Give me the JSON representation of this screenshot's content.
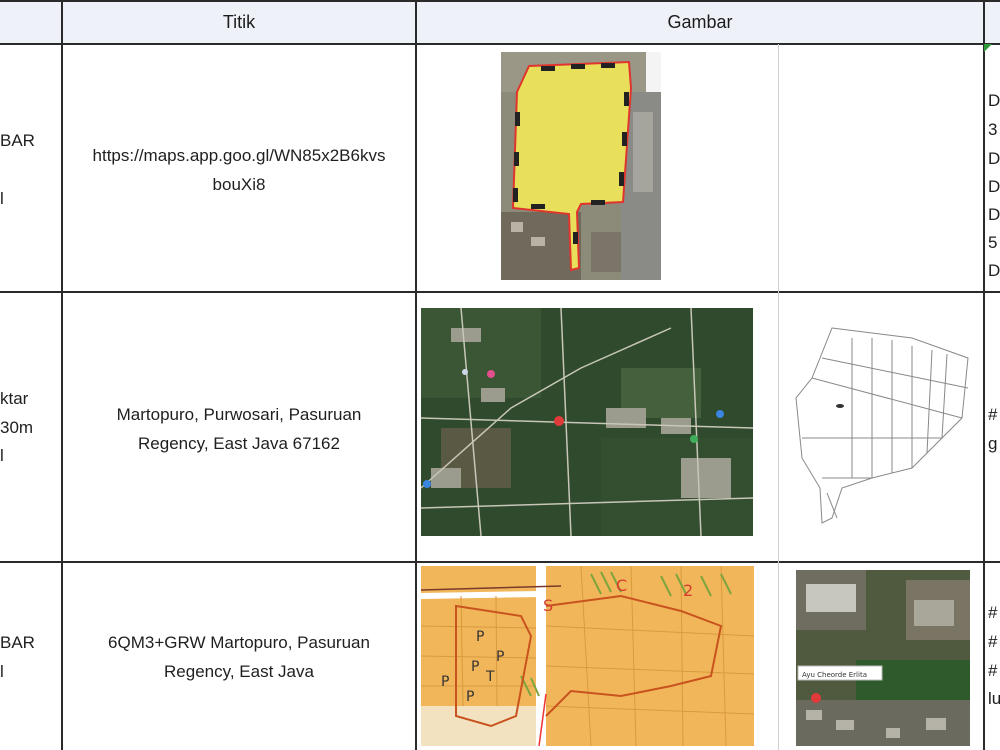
{
  "header": {
    "col_titik": "Titik",
    "col_gambar": "Gambar"
  },
  "rows": [
    {
      "left_fragments": [
        "BAR",
        "l"
      ],
      "titik": [
        "https://maps.app.goo.gl/WN85x2B6kvs",
        "bouXi8"
      ],
      "right_fragments": [
        "D",
        "3",
        "D",
        "D",
        "D",
        "5",
        "D"
      ]
    },
    {
      "left_fragments": [
        "ktar",
        "30m",
        "l"
      ],
      "titik": [
        "Martopuro, Purwosari, Pasuruan",
        "Regency, East Java 67162"
      ],
      "right_fragments": [
        "#",
        "g"
      ]
    },
    {
      "left_fragments": [
        "BAR",
        "l"
      ],
      "titik": [
        "6QM3+GRW Martopuro, Pasuruan",
        "Regency, East Java"
      ],
      "right_fragments": [
        "#",
        "#",
        "#",
        "lu"
      ],
      "map_label": "Ayu Cheorde Erlita"
    }
  ],
  "colors": {
    "header_bg": "#eef2f8",
    "grid_line": "#2a2a2a",
    "plot_yellow": "#e8df5a",
    "plot_border": "#e0342e",
    "cadastral_orange": "#f2b65a",
    "cadastral_line": "#c9531e",
    "vegetation_green": "#2f5a2c"
  },
  "icons": [
    "map-pin-icon",
    "marker-icon"
  ]
}
